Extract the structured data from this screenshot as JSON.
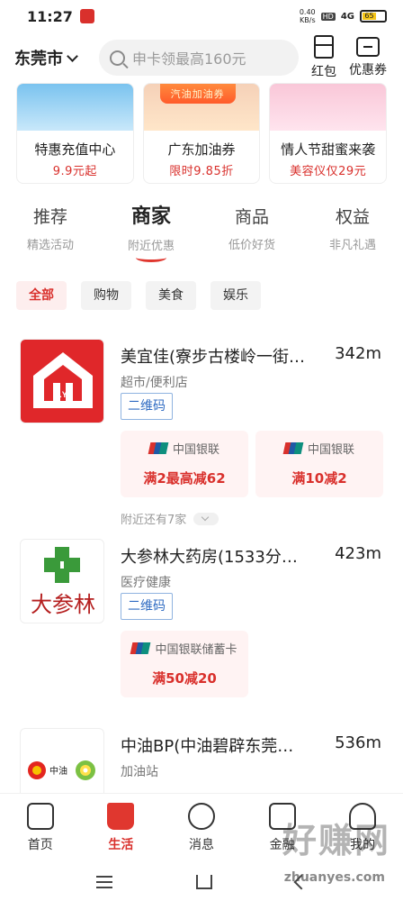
{
  "status": {
    "time": "11:27",
    "speed": "0.40\nKB/s",
    "hd": "HD",
    "signal": "4G",
    "battery": "65"
  },
  "header": {
    "city": "东莞市",
    "search_placeholder": "申卡领最高160元",
    "redpack": "红包",
    "coupon": "优惠券"
  },
  "banners": [
    {
      "title": "特惠充值中心",
      "sub": "9.9元起"
    },
    {
      "title": "广东加油券",
      "sub": "限时9.85折",
      "art_label": "汽油加油券"
    },
    {
      "title": "情人节甜蜜来袭",
      "sub": "美容仪仅29元"
    }
  ],
  "tabs": [
    {
      "main": "推荐",
      "sub": "精选活动"
    },
    {
      "main": "商家",
      "sub": "附近优惠"
    },
    {
      "main": "商品",
      "sub": "低价好货"
    },
    {
      "main": "权益",
      "sub": "非凡礼遇"
    }
  ],
  "filters": [
    "全部",
    "购物",
    "美食",
    "娱乐"
  ],
  "merchants": [
    {
      "name": "美宜佳(寮步古楼岭一街…",
      "distance": "342m",
      "category": "超市/便利店",
      "tag": "二维码",
      "logo_text": "M.Y.J",
      "offers": [
        {
          "bank": "中国银联",
          "deal": "满2最高减62"
        },
        {
          "bank": "中国银联",
          "deal": "满10减2"
        }
      ],
      "nearby": "附近还有7家"
    },
    {
      "name": "大参林大药房(1533分…",
      "distance": "423m",
      "category": "医疗健康",
      "tag": "二维码",
      "logo_text": "大参林",
      "offers": [
        {
          "bank": "中国银联储蓄卡",
          "deal": "满50减20"
        }
      ]
    },
    {
      "name": "中油BP(中油碧辟东莞…",
      "distance": "536m",
      "category": "加油站",
      "logo_text": "中油"
    }
  ],
  "bottom_nav": [
    {
      "label": "首页",
      "icon": "home-icon"
    },
    {
      "label": "生活",
      "icon": "life-cup-icon"
    },
    {
      "label": "消息",
      "icon": "message-icon"
    },
    {
      "label": "金融",
      "icon": "card-icon"
    },
    {
      "label": "我的",
      "icon": "person-icon"
    }
  ],
  "watermark": {
    "text": "好赚网",
    "url": "zhuanyes.com"
  },
  "colors": {
    "accent": "#d9302c",
    "qr_blue": "#2f6bc2",
    "chip_active_bg": "#fdeeee"
  }
}
